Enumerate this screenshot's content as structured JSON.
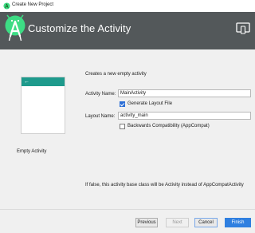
{
  "window": {
    "title": "Create New Project"
  },
  "header": {
    "title": "Customize the Activity"
  },
  "preview": {
    "label": "Empty Activity",
    "back_arrow": "←"
  },
  "form": {
    "description": "Creates a new empty activity",
    "activity_name_label": "Activity Name:",
    "activity_name_value": "MainActivity",
    "generate_layout_label": "Generate Layout File",
    "generate_layout_checked": true,
    "layout_name_label": "Layout Name:",
    "layout_name_value": "activity_main",
    "backwards_compat_label": "Backwards Compatibility (AppCompat)",
    "backwards_compat_checked": false,
    "info_text": "If false, this activity base class will be Activity instead of AppCompatActivity"
  },
  "buttons": {
    "previous": "Previous",
    "next": "Next",
    "cancel": "Cancel",
    "finish": "Finish"
  },
  "colors": {
    "header_bg": "#53585a",
    "accent_teal": "#1e9a8c",
    "primary_button": "#2f7fe0",
    "checkbox_checked": "#2d6fd6"
  },
  "icons": [
    "android-studio-icon",
    "android-studio-logo-icon",
    "device-icon",
    "back-arrow-icon",
    "checkbox-checked-icon"
  ]
}
